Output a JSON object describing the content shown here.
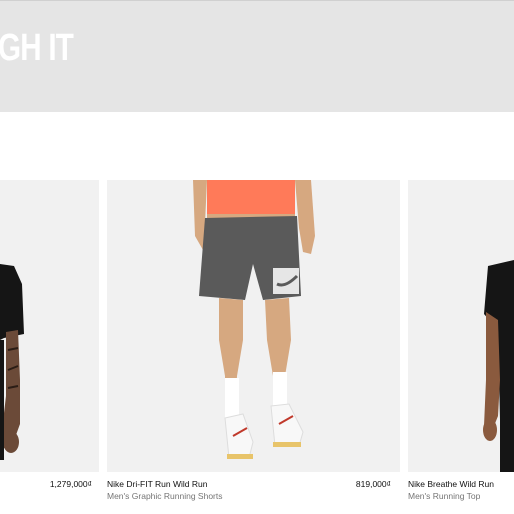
{
  "banner": {
    "text": "GH IT"
  },
  "products": [
    {
      "title": "",
      "subtitle": "",
      "price": "1,279,000₫"
    },
    {
      "title": "Nike Dri-FIT Run Wild Run",
      "subtitle": "Men's Graphic Running Shorts",
      "price": "819,000₫"
    },
    {
      "title": "Nike Breathe Wild Run",
      "subtitle": "Men's Running Top",
      "price": ""
    }
  ],
  "colors": {
    "banner_bg": "#e5e5e5",
    "card_bg": "#f1f1f1",
    "shirt_orange": "#ff7a59",
    "shorts_grey": "#5a5a5a"
  }
}
